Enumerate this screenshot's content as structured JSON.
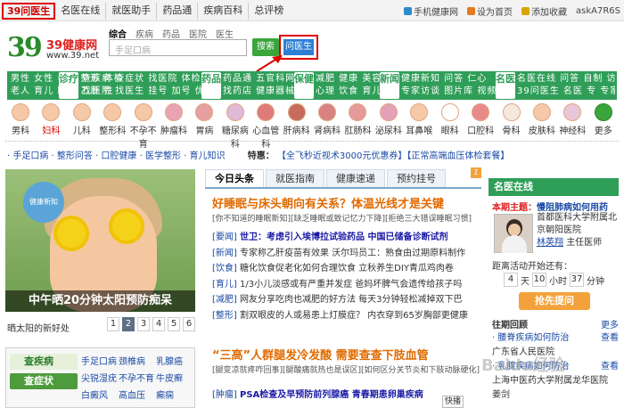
{
  "topbar": {
    "nav": [
      "39问医生",
      "名医在线",
      "就医助手",
      "药品通",
      "疾病百科",
      "总评榜"
    ],
    "right": [
      "手机健康网",
      "设为首页",
      "添加收藏",
      "askA7R6S"
    ]
  },
  "header": {
    "logo_main": "39",
    "logo_cn": "39健康网",
    "logo_url": "www.39.net",
    "search_tabs": [
      "综合",
      "疾病",
      "药品",
      "医院",
      "医生"
    ],
    "search_placeholder": "手足口病",
    "search_button": "搜索",
    "ask_button": "问医生"
  },
  "green_nav": {
    "b1": [
      "男性 女性 母婴 整形 体检",
      "老人 育儿 肿瘤 乙肝 性"
    ],
    "tag1": "诊疗",
    "b2": [
      "查疾病 查症状 找医院 体检",
      "找医院 找医生 挂号 加号 优惠"
    ],
    "tag2": "药品",
    "b3": [
      "药品通 五官科网",
      "找药店 健康器械"
    ],
    "tag3": "保健",
    "b4": [
      "减肥 健康 美容",
      "心理 饮食 育儿"
    ],
    "tag4": "新闻",
    "b5": [
      "健康新知 问答 仁心",
      "专家访谈 图片库 视频"
    ],
    "tag5": "名医",
    "b6": [
      "名医在线 问答 自制 访谈",
      "39问医生 名医 专 专家"
    ]
  },
  "body_icons": [
    "男科",
    "妇科",
    "儿科",
    "整形科",
    "不孕不育",
    "肿瘤科",
    "胃病",
    "糖尿病科",
    "心血管科",
    "肝病科",
    "肾病科",
    "肛肠科",
    "泌尿科",
    "耳鼻喉",
    "眼科",
    "口腔科",
    "骨科",
    "皮肤科",
    "神经科",
    "更多"
  ],
  "strip": {
    "links": "· 手足口病 · 整形问答 · 口腔健康 · 医学整形 · 育儿知识",
    "label": "特惠：",
    "promos": "【全飞秒近视术3000元优惠券】【正常高端血压体检套餐】"
  },
  "feature": {
    "caption": "中午晒20分钟太阳预防痴呆",
    "badge": "健康新知",
    "sub": "晒太阳的新好处",
    "pages": [
      "1",
      "2",
      "3",
      "4",
      "5",
      "6"
    ]
  },
  "leftbox": {
    "btn1": "查疾病",
    "btn2": "查症状",
    "grid": [
      "手足口病",
      "颈椎病",
      "乳腺癌",
      "尖锐湿疣",
      "不孕不育",
      "牛皮癣",
      "白癜风",
      "高血压",
      "癫痫"
    ]
  },
  "news": {
    "tabs": [
      "今日头条",
      "就医指南",
      "健康速递",
      "预约挂号"
    ],
    "num": "1",
    "headline": "好睡眠与床头朝向有关系？体温光线才是关键",
    "subhead": "[你不知道的睡眠新知][缺乏睡眠或致记忆力下降][拒绝三大错误睡眠习惯]",
    "items": [
      {
        "cat": "[要闻]",
        "text": "世卫：考虑引入埃博拉试验药品 中国已储备诊断试剂",
        "bold": true
      },
      {
        "cat": "[新闻]",
        "text": "专家称乙肝疫苗有效果 沃尔玛员工：熟食由过期原料制作",
        "bold": false
      },
      {
        "cat": "[饮食]",
        "text": "糖化饮食促老化如何合理饮食 立秋养生DIY青瓜鸡肉卷",
        "bold": false
      },
      {
        "cat": "[育儿]",
        "text": "1/3小儿淡感或有严重并发症 爸妈坏脾气会遗传给孩子吗",
        "bold": false
      },
      {
        "cat": "[减肥]",
        "text": "网友分享吃肉也减肥的好方法 每天3分钟轻松减掉双下巴",
        "bold": false
      },
      {
        "cat": "[整形]",
        "text": "割双眼皮的人或易患上灯膜症？ 内衣穿到65岁胸部更健康",
        "bold": false
      }
    ],
    "headline2": "“三高”人群腿发冷发酸 需要查查下肢血管",
    "subhead2": "[腿变凉就疼咋回事][腿酸痛就热也是误区][如何区分关节炎和下肢动脉硬化]",
    "last_cat": "[肿瘤]",
    "last_text": "PSA检查及早预防前列腺癌 青春期患卵巢疾病",
    "kuai": "快播"
  },
  "right": {
    "header": "名医在线",
    "period_label": "本期主题：",
    "period_title": "慢阻肺病如何用药",
    "hospital": "首都医科大学附属北京朝阳医院",
    "doctor": "林英翔",
    "title": "主任医师",
    "countdown_label": "距离活动开始还有：",
    "countdown": [
      "4",
      "天",
      "10",
      "小时",
      "37",
      "分钟"
    ],
    "ask_button": "抢先提问",
    "past_title": "往期回顾",
    "more": "更多",
    "past": [
      {
        "text": "· 腰脊疾病如何防治",
        "more": "查看"
      },
      {
        "text": "广东省人民医院",
        "more": ""
      },
      {
        "text": "· 乳腺疾病如何防治",
        "more": "查看"
      },
      {
        "text": "上海中医药大学附属龙华医院 姜剑",
        "more": ""
      }
    ],
    "watermark": "Baidu经验"
  }
}
